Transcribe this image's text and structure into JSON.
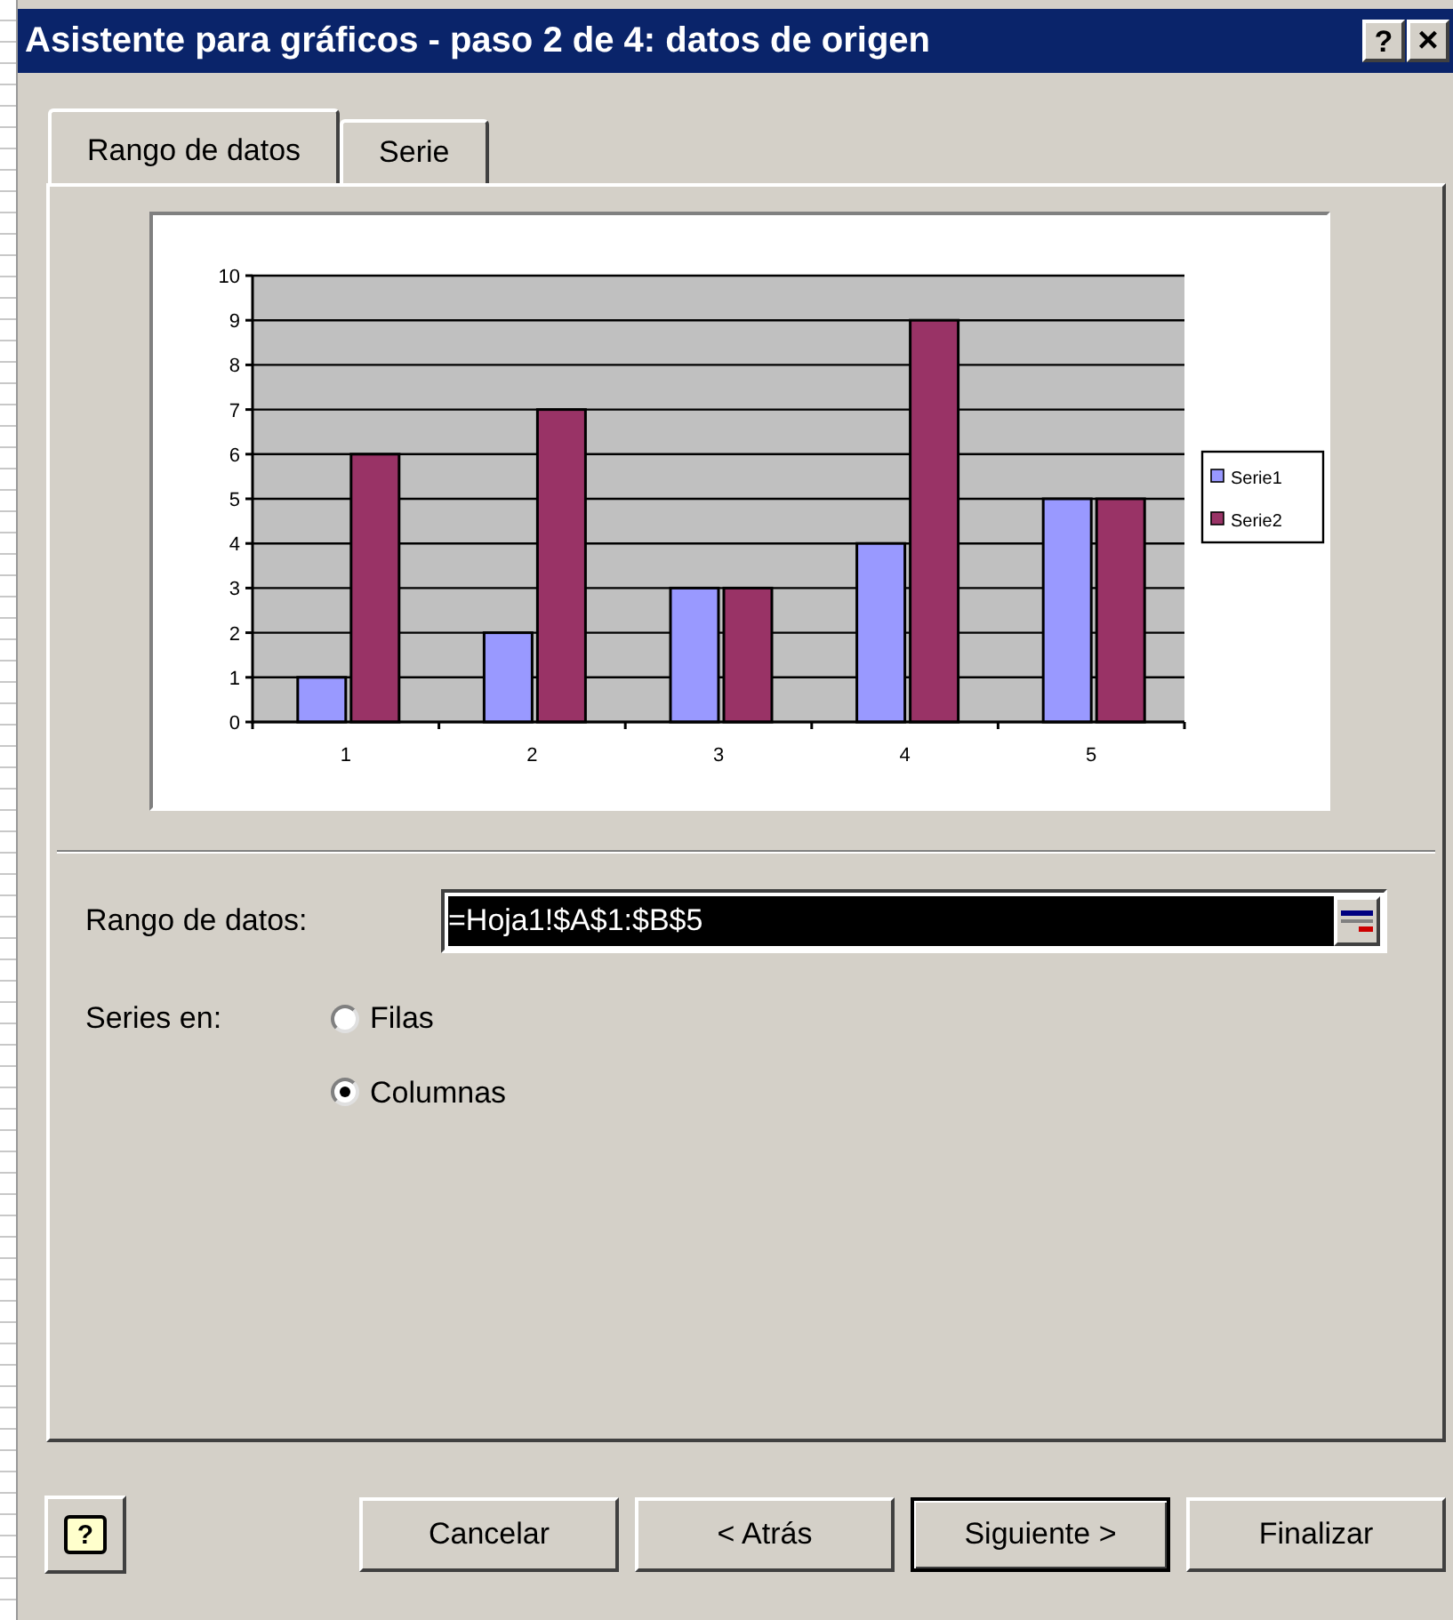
{
  "window": {
    "title": "Asistente para gráficos - paso 2 de 4: datos de origen",
    "controls": [
      {
        "kind": "help",
        "label": "?"
      },
      {
        "kind": "close",
        "label": "×"
      }
    ]
  },
  "tabs": [
    {
      "label": "Rango de datos",
      "selected": true
    },
    {
      "label": "Serie",
      "selected": false
    }
  ],
  "chart_data": {
    "type": "bar",
    "categories": [
      "1",
      "2",
      "3",
      "4",
      "5"
    ],
    "series": [
      {
        "name": "Serie1",
        "color": "#9999ff",
        "values": [
          1,
          2,
          3,
          4,
          5
        ]
      },
      {
        "name": "Serie2",
        "color": "#993366",
        "values": [
          6,
          7,
          3,
          9,
          5
        ]
      }
    ],
    "ylim": [
      0,
      10
    ],
    "grid": true,
    "legend": true,
    "yticks": [
      0,
      1,
      2,
      3,
      4,
      5,
      6,
      7,
      8,
      9,
      10
    ]
  },
  "range": {
    "label": "Rango de datos:",
    "value": "=Hoja1!$A$1:$B$5"
  },
  "series_in": {
    "label": "Series en:",
    "options": [
      {
        "label": "Filas",
        "selected": false
      },
      {
        "label": "Columnas",
        "selected": true
      }
    ]
  },
  "buttons": [
    {
      "kind": "help",
      "label": "?"
    },
    {
      "kind": "normal",
      "label": "Cancelar"
    },
    {
      "kind": "normal",
      "label": "< Atrás"
    },
    {
      "kind": "default",
      "label": "Siguiente >"
    },
    {
      "kind": "normal",
      "label": "Finalizar"
    }
  ]
}
